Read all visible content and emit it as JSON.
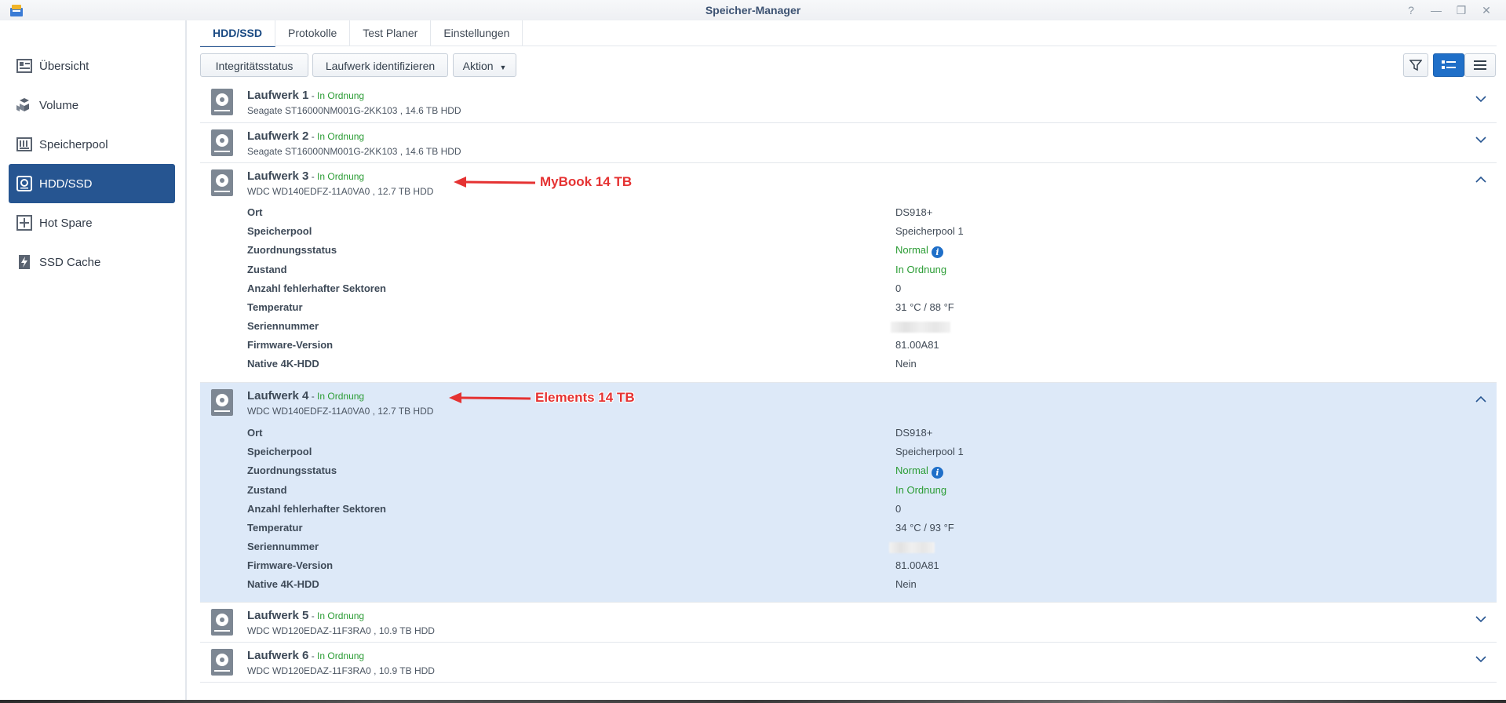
{
  "window": {
    "title": "Speicher-Manager",
    "controls": [
      "?",
      "—",
      "❐",
      "✕"
    ]
  },
  "sidebar": {
    "items": [
      {
        "label": "Übersicht",
        "icon": "overview-icon"
      },
      {
        "label": "Volume",
        "icon": "volume-icon"
      },
      {
        "label": "Speicherpool",
        "icon": "storage-pool-icon"
      },
      {
        "label": "HDD/SSD",
        "icon": "hdd-icon",
        "active": true
      },
      {
        "label": "Hot Spare",
        "icon": "hot-spare-icon"
      },
      {
        "label": "SSD Cache",
        "icon": "ssd-cache-icon"
      }
    ]
  },
  "tabs": [
    "HDD/SSD",
    "Protokolle",
    "Test Planer",
    "Einstellungen"
  ],
  "toolbar": {
    "integrity": "Integritätsstatus",
    "identify": "Laufwerk identifizieren",
    "action": "Aktion"
  },
  "drives": [
    {
      "name": "Laufwerk 1",
      "status": "In Ordnung",
      "model": "Seagate ST16000NM001G-2KK103 , 14.6 TB HDD"
    },
    {
      "name": "Laufwerk 2",
      "status": "In Ordnung",
      "model": "Seagate ST16000NM001G-2KK103 , 14.6 TB HDD"
    },
    {
      "name": "Laufwerk 3",
      "status": "In Ordnung",
      "model": "WDC WD140EDFZ-11A0VA0 , 12.7 TB HDD",
      "details": {
        "ort": "DS918+",
        "pool": "Speicherpool 1",
        "zuordnung": "Normal",
        "zustand": "In Ordnung",
        "sektoren": "0",
        "temp": "31 °C / 88 °F",
        "firmware": "81.00A81",
        "native4k": "Nein"
      }
    },
    {
      "name": "Laufwerk 4",
      "status": "In Ordnung",
      "model": "WDC WD140EDFZ-11A0VA0 , 12.7 TB HDD",
      "details": {
        "ort": "DS918+",
        "pool": "Speicherpool 1",
        "zuordnung": "Normal",
        "zustand": "In Ordnung",
        "sektoren": "0",
        "temp": "34 °C / 93 °F",
        "firmware": "81.00A81",
        "native4k": "Nein"
      }
    },
    {
      "name": "Laufwerk 5",
      "status": "In Ordnung",
      "model": "WDC WD120EDAZ-11F3RA0 , 10.9 TB HDD"
    },
    {
      "name": "Laufwerk 6",
      "status": "In Ordnung",
      "model": "WDC WD120EDAZ-11F3RA0 , 10.9 TB HDD"
    }
  ],
  "labels": {
    "ort": "Ort",
    "pool": "Speicherpool",
    "zuordnung": "Zuordnungsstatus",
    "zustand": "Zustand",
    "sektoren": "Anzahl fehlerhafter Sektoren",
    "temp": "Temperatur",
    "serial": "Seriennummer",
    "firmware": "Firmware-Version",
    "native4k": "Native 4K-HDD"
  },
  "annotations": {
    "mybook": "MyBook 14 TB",
    "elements": "Elements 14 TB"
  },
  "colors": {
    "accent": "#265591",
    "status_green": "#2a9c34",
    "highlight_row": "#dde9f8",
    "annotation_red": "#e53232"
  }
}
